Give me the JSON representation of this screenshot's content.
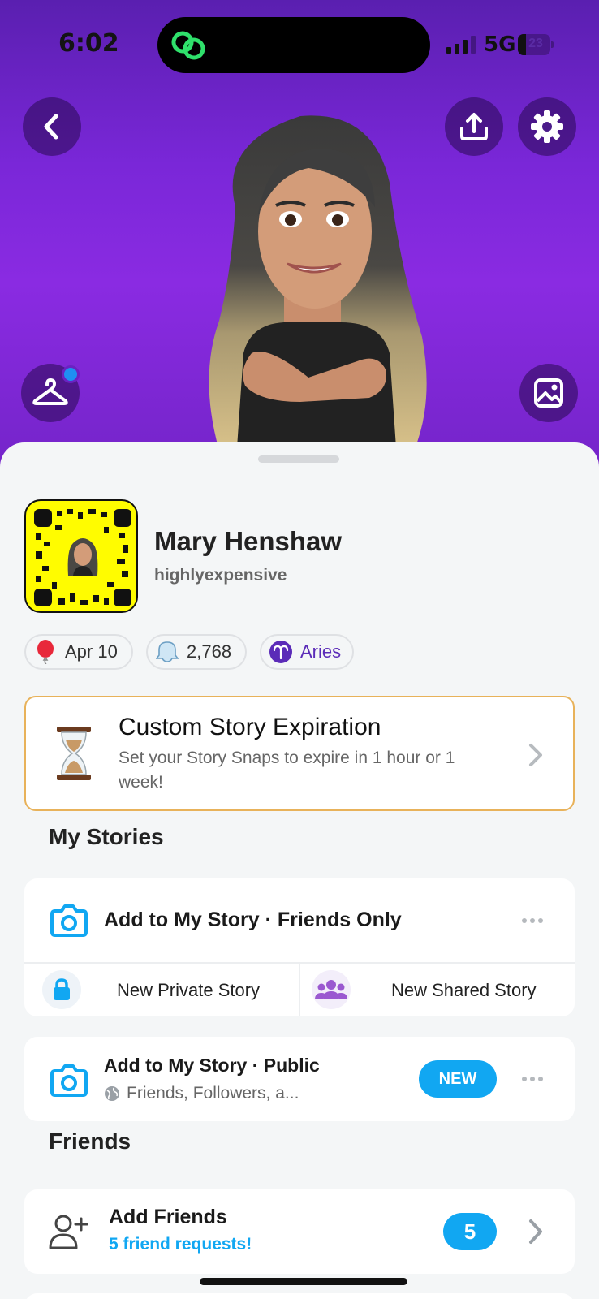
{
  "status_bar": {
    "time": "6:02",
    "network": "5G",
    "battery": "23"
  },
  "profile": {
    "display_name": "Mary Henshaw",
    "username": "highlyexpensive"
  },
  "chips": {
    "birthday": "Apr 10",
    "snap_score": "2,768",
    "zodiac": "Aries"
  },
  "promo": {
    "title": "Custom Story Expiration",
    "subtitle": "Set your Story Snaps to expire in 1 hour or 1 week!"
  },
  "my_stories": {
    "section_title": "My Stories",
    "friends_only_label": "Add to My Story · Friends Only",
    "private_story_label": "New Private Story",
    "shared_story_label": "New Shared Story",
    "public_label": "Add to My Story · Public",
    "public_audience": "Friends, Followers, a...",
    "new_badge": "NEW"
  },
  "friends": {
    "section_title": "Friends",
    "add_friends_label": "Add Friends",
    "requests_text": "5 friend requests!",
    "request_count": "5"
  },
  "colors": {
    "accent_blue": "#11a7f2",
    "hero_purple": "#8a2be2",
    "snapcode_yellow": "#fffc00",
    "promo_border": "#e8b25a"
  },
  "icons": [
    "back-icon",
    "share-icon",
    "settings-icon",
    "hanger-icon",
    "photo-icon",
    "camera-icon",
    "lock-icon",
    "group-icon",
    "globe-icon",
    "add-friend-icon",
    "more-icon",
    "chevron-right-icon",
    "hourglass-icon",
    "balloon-icon",
    "ghost-icon",
    "aries-icon"
  ]
}
